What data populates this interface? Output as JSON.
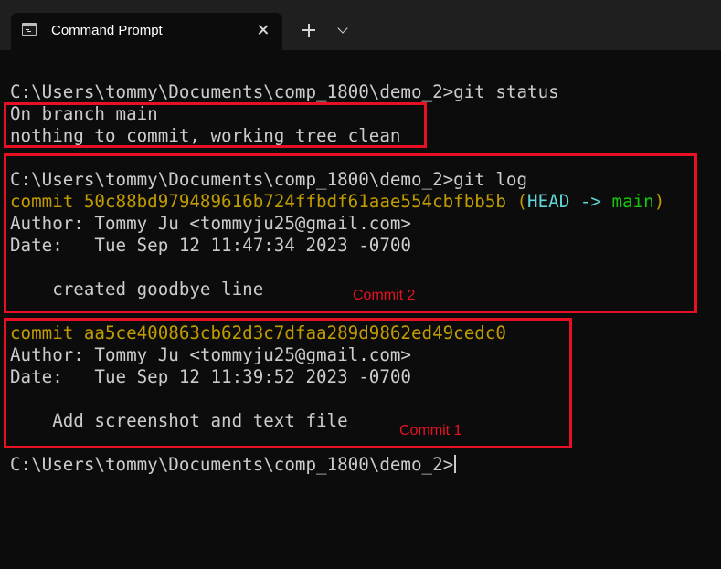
{
  "window": {
    "tab_title": "Command Prompt",
    "tab_icon": "cmd-console-icon",
    "close_icon": "close-icon",
    "new_tab_icon": "plus-icon",
    "dropdown_icon": "chevron-down-icon"
  },
  "terminal": {
    "lines": [
      {
        "text": "C:\\Users\\tommy\\Documents\\comp_1800\\demo_2>git status"
      },
      {
        "text": "On branch main"
      },
      {
        "text": "nothing to commit, working tree clean"
      },
      {
        "text": "C:\\Users\\tommy\\Documents\\comp_1800\\demo_2>git log"
      },
      {
        "commit_prefix": "commit 50c88bd979489616b724ffbdf61aae554cbfbb5b",
        "open_paren": " (",
        "head": "HEAD",
        "arrow": " -> ",
        "branch": "main",
        "close_paren": ")"
      },
      {
        "text": "Author: Tommy Ju <tommyju25@gmail.com>"
      },
      {
        "text": "Date:   Tue Sep 12 11:47:34 2023 -0700"
      },
      {
        "text": "    created goodbye line"
      },
      {
        "text": "commit aa5ce400863cb62d3c7dfaa289d9862ed49cedc0"
      },
      {
        "text": "Author: Tommy Ju <tommyju25@gmail.com>"
      },
      {
        "text": "Date:   Tue Sep 12 11:39:52 2023 -0700"
      },
      {
        "text": "    Add screenshot and text file"
      },
      {
        "text": "C:\\Users\\tommy\\Documents\\comp_1800\\demo_2>"
      }
    ]
  },
  "annotations": {
    "commit2_label": "Commit 2",
    "commit1_label": "Commit 1"
  },
  "colors": {
    "background": "#0c0c0c",
    "text": "#cccccc",
    "commit_hash": "#c19c00",
    "head": "#61d6d6",
    "branch": "#16c60c",
    "annotation_red": "#e81123"
  }
}
